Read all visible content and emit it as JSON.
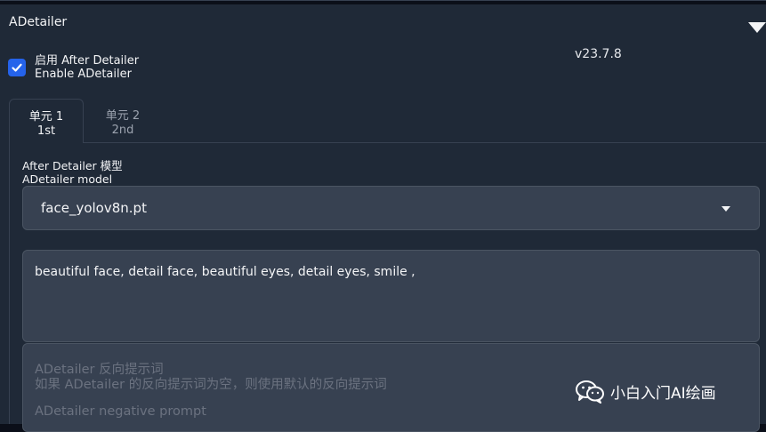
{
  "panel": {
    "title": "ADetailer",
    "version": "v23.7.8",
    "enable": {
      "checked": true,
      "label_cn": "启用 After Detailer",
      "label_en": "Enable ADetailer"
    }
  },
  "tabs": [
    {
      "line1": "单元 1",
      "line2": "1st",
      "active": true
    },
    {
      "line1": "单元 2",
      "line2": "2nd",
      "active": false
    }
  ],
  "model": {
    "label_cn": "After Detailer 模型",
    "label_en": "ADetailer model",
    "value": "face_yolov8n.pt"
  },
  "prompt": {
    "value": "beautiful face, detail face, beautiful eyes, detail eyes, smile ,"
  },
  "negative_prompt": {
    "placeholder_cn_title": "ADetailer 反向提示词",
    "placeholder_cn_hint": "如果 ADetailer 的反向提示词为空，则使用默认的反向提示词",
    "placeholder_en_title": "ADetailer negative prompt"
  },
  "watermark": {
    "text": "小白入门AI绘画"
  },
  "colors": {
    "accent": "#2563eb",
    "panel_bg": "#1f2937",
    "input_bg": "#374151"
  }
}
